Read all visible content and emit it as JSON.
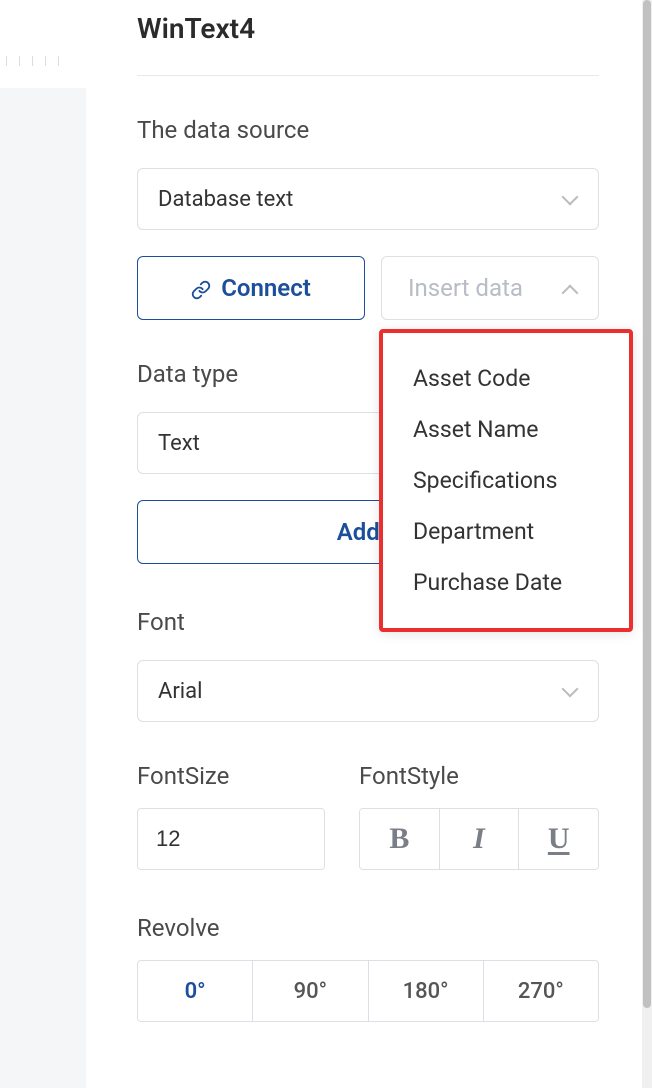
{
  "title": "WinText4",
  "dataSource": {
    "label": "The data source",
    "selected": "Database text",
    "connectLabel": "Connect",
    "insertPlaceholder": "Insert data",
    "options": [
      "Asset Code",
      "Asset Name",
      "Specifications",
      "Department",
      "Purchase Date"
    ]
  },
  "dataType": {
    "label": "Data type",
    "selected": "Text",
    "addButton": "Add d"
  },
  "font": {
    "label": "Font",
    "selected": "Arial"
  },
  "fontSize": {
    "label": "FontSize",
    "value": "12"
  },
  "fontStyle": {
    "label": "FontStyle",
    "bold": "B",
    "italic": "I",
    "underline": "U"
  },
  "revolve": {
    "label": "Revolve",
    "options": [
      "0°",
      "90°",
      "180°",
      "270°"
    ],
    "active": 0
  }
}
